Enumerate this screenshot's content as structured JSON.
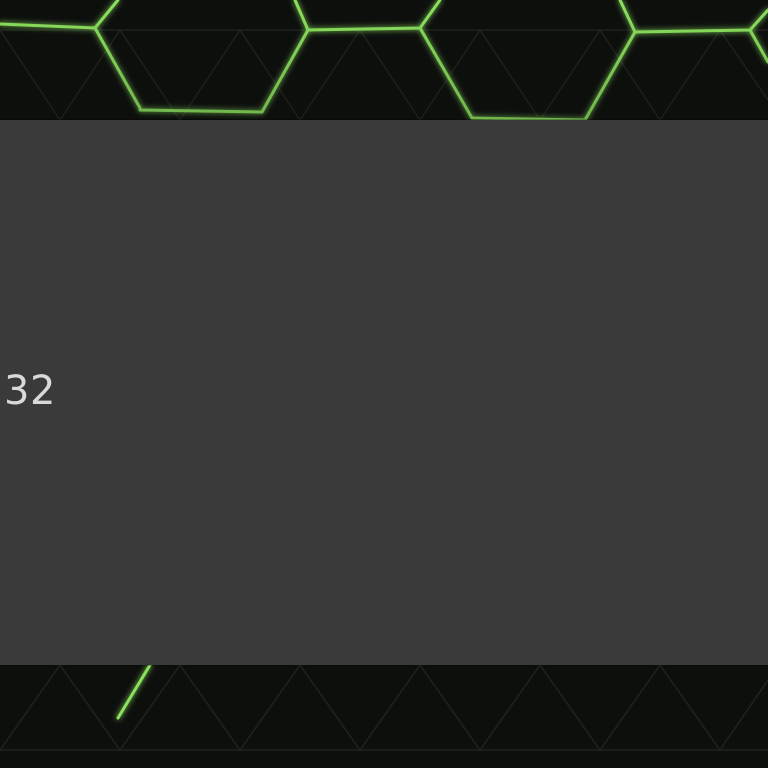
{
  "background": {
    "pattern_icon": "hexagon-grid-icon",
    "base_color": "#0d0f0d",
    "line_color": "#1f231f",
    "glow_color": "#7ed957"
  },
  "panel": {
    "color": "#3a3a3b",
    "value_text": "32",
    "text_color": "#d9d9d9"
  }
}
